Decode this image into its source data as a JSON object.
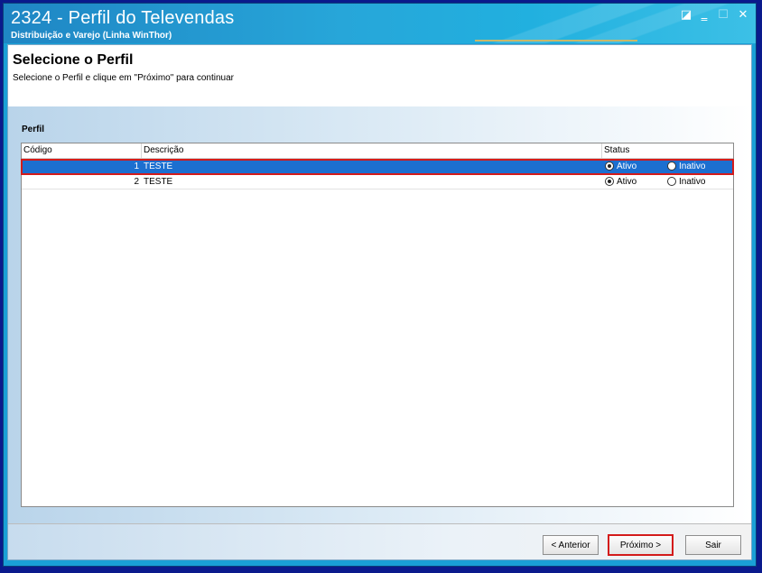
{
  "window": {
    "title": "2324 - Perfil do Televendas",
    "subtitle": "Distribuição e Varejo (Linha WinThor)",
    "controls": {
      "restore": "◪",
      "minimize": "‗",
      "maximize": "☐",
      "close": "✕"
    }
  },
  "header": {
    "title": "Selecione o Perfil",
    "instruction": "Selecione o Perfil e clique em \"Próximo\" para continuar"
  },
  "perfil": {
    "group_label": "Perfil",
    "columns": [
      "Código",
      "Descrição",
      "Status"
    ],
    "rows": [
      {
        "code": "1",
        "description": "TESTE",
        "status_ativo": "Ativo",
        "status_inativo": "Inativo",
        "selected_status": "Ativo",
        "row_selected": true
      },
      {
        "code": "2",
        "description": "TESTE",
        "status_ativo": "Ativo",
        "status_inativo": "Inativo",
        "selected_status": "Ativo",
        "row_selected": false
      }
    ]
  },
  "footer": {
    "anterior": "< Anterior",
    "proximo": "Próximo >",
    "sair": "Sair"
  },
  "colors": {
    "title_bar": "#27a6d9",
    "selection": "#1c6fd0",
    "highlight_outline": "#d31b1b"
  }
}
